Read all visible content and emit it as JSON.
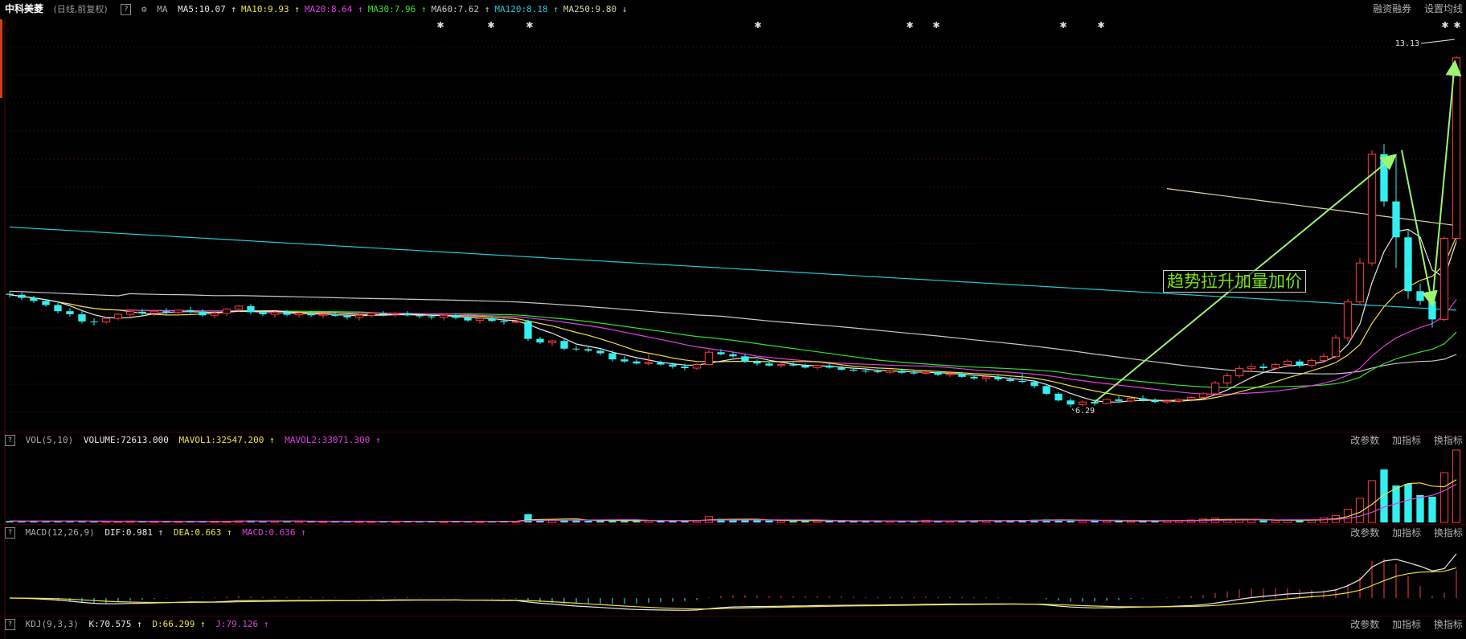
{
  "header": {
    "title": "中科美菱",
    "subtitle": "(日线,前复权)",
    "ma_label": "MA",
    "ma_items": [
      {
        "text": "MA5:10.07",
        "arrow": "↑",
        "color": "#e8e8e8"
      },
      {
        "text": "MA10:9.93",
        "arrow": "↑",
        "color": "#f0e040"
      },
      {
        "text": "MA20:8.64",
        "arrow": "↑",
        "color": "#e040e0"
      },
      {
        "text": "MA30:7.96",
        "arrow": "↑",
        "color": "#30e030"
      },
      {
        "text": "MA60:7.62",
        "arrow": "↑",
        "color": "#c8c8c8"
      },
      {
        "text": "MA120:8.18",
        "arrow": "↑",
        "color": "#20c8d8"
      },
      {
        "text": "MA250:9.80",
        "arrow": "↓",
        "color": "#d8d8a0"
      }
    ],
    "right_links": [
      "融资融券",
      "设置均线"
    ]
  },
  "vol_header": {
    "label": "VOL(5,10)",
    "volume": "VOLUME:72613.000",
    "mavol1": "MAVOL1:32547.200",
    "mavol2": "MAVOL2:33071.300",
    "links": [
      "改参数",
      "加指标",
      "换指标"
    ]
  },
  "macd_header": {
    "label": "MACD(12,26,9)",
    "dif": "DIF:0.981",
    "dea": "DEA:0.663",
    "macd": "MACD:0.636",
    "links": [
      "改参数",
      "加指标",
      "换指标"
    ]
  },
  "kdj_header": {
    "label": "KDJ(9,3,3)",
    "k": "K:70.575",
    "d": "D:66.299",
    "j": "J:79.126",
    "links": [
      "改参数",
      "加指标",
      "换指标"
    ]
  },
  "price_labels": {
    "high": "13.13",
    "low": "6.29"
  },
  "annotation": "趋势拉升加量加价",
  "chart_data": {
    "type": "candlestick",
    "ohlc": [
      [
        8.5,
        8.55,
        8.43,
        8.48
      ],
      [
        8.48,
        8.52,
        8.38,
        8.42
      ],
      [
        8.42,
        8.46,
        8.32,
        8.36
      ],
      [
        8.36,
        8.4,
        8.25,
        8.28
      ],
      [
        8.28,
        8.32,
        8.12,
        8.16
      ],
      [
        8.16,
        8.22,
        8.05,
        8.1
      ],
      [
        8.1,
        8.16,
        7.92,
        7.96
      ],
      [
        7.96,
        8.02,
        7.88,
        7.95
      ],
      [
        7.95,
        8.05,
        7.92,
        8.02
      ],
      [
        8.02,
        8.12,
        7.98,
        8.1
      ],
      [
        8.1,
        8.18,
        8.05,
        8.15
      ],
      [
        8.15,
        8.2,
        8.08,
        8.12
      ],
      [
        8.12,
        8.18,
        8.06,
        8.16
      ],
      [
        8.16,
        8.22,
        8.1,
        8.14
      ],
      [
        8.14,
        8.2,
        8.08,
        8.18
      ],
      [
        8.18,
        8.24,
        8.12,
        8.15
      ],
      [
        8.15,
        8.2,
        8.05,
        8.08
      ],
      [
        8.08,
        8.14,
        8.02,
        8.12
      ],
      [
        8.12,
        8.22,
        8.06,
        8.2
      ],
      [
        8.2,
        8.28,
        8.15,
        8.26
      ],
      [
        8.26,
        8.3,
        8.1,
        8.14
      ],
      [
        8.14,
        8.18,
        8.06,
        8.1
      ],
      [
        8.1,
        8.16,
        8.04,
        8.14
      ],
      [
        8.14,
        8.18,
        8.06,
        8.09
      ],
      [
        8.09,
        8.14,
        8.04,
        8.12
      ],
      [
        8.12,
        8.16,
        8.05,
        8.08
      ],
      [
        8.08,
        8.12,
        8.02,
        8.1
      ],
      [
        8.1,
        8.15,
        8.05,
        8.07
      ],
      [
        8.07,
        8.12,
        8.0,
        8.04
      ],
      [
        8.04,
        8.1,
        7.98,
        8.08
      ],
      [
        8.08,
        8.14,
        8.04,
        8.12
      ],
      [
        8.12,
        8.16,
        8.06,
        8.1
      ],
      [
        8.1,
        8.14,
        8.04,
        8.12
      ],
      [
        8.12,
        8.16,
        8.06,
        8.08
      ],
      [
        8.08,
        8.12,
        8.02,
        8.06
      ],
      [
        8.06,
        8.1,
        8.0,
        8.04
      ],
      [
        8.04,
        8.1,
        7.98,
        8.08
      ],
      [
        8.08,
        8.12,
        8.0,
        8.03
      ],
      [
        8.03,
        8.08,
        7.95,
        7.98
      ],
      [
        7.98,
        8.04,
        7.92,
        8.02
      ],
      [
        8.02,
        8.06,
        7.95,
        7.97
      ],
      [
        7.97,
        8.02,
        7.9,
        7.95
      ],
      [
        7.95,
        8.0,
        7.92,
        7.96
      ],
      [
        7.96,
        8.0,
        7.58,
        7.62
      ],
      [
        7.62,
        7.66,
        7.52,
        7.55
      ],
      [
        7.55,
        7.6,
        7.48,
        7.58
      ],
      [
        7.58,
        7.62,
        7.4,
        7.43
      ],
      [
        7.43,
        7.48,
        7.38,
        7.42
      ],
      [
        7.42,
        7.46,
        7.36,
        7.39
      ],
      [
        7.39,
        7.42,
        7.3,
        7.34
      ],
      [
        7.34,
        7.4,
        7.18,
        7.22
      ],
      [
        7.22,
        7.28,
        7.15,
        7.18
      ],
      [
        7.18,
        7.22,
        7.12,
        7.14
      ],
      [
        7.14,
        7.32,
        7.1,
        7.16
      ],
      [
        7.16,
        7.2,
        7.1,
        7.12
      ],
      [
        7.12,
        7.16,
        7.04,
        7.08
      ],
      [
        7.08,
        7.14,
        7.0,
        7.05
      ],
      [
        7.05,
        7.15,
        7.02,
        7.12
      ],
      [
        7.12,
        7.4,
        7.1,
        7.36
      ],
      [
        7.36,
        7.42,
        7.3,
        7.32
      ],
      [
        7.32,
        7.36,
        7.25,
        7.28
      ],
      [
        7.28,
        7.32,
        7.15,
        7.18
      ],
      [
        7.18,
        7.22,
        7.1,
        7.14
      ],
      [
        7.14,
        7.18,
        7.08,
        7.1
      ],
      [
        7.1,
        7.14,
        7.06,
        7.12
      ],
      [
        7.12,
        7.16,
        7.08,
        7.1
      ],
      [
        7.1,
        7.14,
        7.04,
        7.06
      ],
      [
        7.06,
        7.12,
        7.02,
        7.1
      ],
      [
        7.1,
        7.14,
        7.04,
        7.06
      ],
      [
        7.06,
        7.1,
        7.0,
        7.02
      ],
      [
        7.02,
        7.06,
        6.98,
        7.0
      ],
      [
        7.0,
        7.04,
        6.96,
        6.99
      ],
      [
        6.99,
        7.03,
        6.95,
        6.97
      ],
      [
        6.97,
        7.02,
        6.94,
        7.0
      ],
      [
        7.0,
        7.04,
        6.94,
        6.96
      ],
      [
        6.96,
        7.0,
        6.92,
        6.95
      ],
      [
        6.95,
        7.0,
        6.92,
        6.97
      ],
      [
        6.97,
        7.0,
        6.9,
        6.92
      ],
      [
        6.92,
        6.96,
        6.88,
        6.94
      ],
      [
        6.94,
        6.98,
        6.86,
        6.88
      ],
      [
        6.88,
        6.92,
        6.82,
        6.85
      ],
      [
        6.85,
        6.9,
        6.78,
        6.88
      ],
      [
        6.88,
        6.92,
        6.8,
        6.83
      ],
      [
        6.83,
        6.88,
        6.78,
        6.8
      ],
      [
        6.8,
        6.96,
        6.76,
        6.78
      ],
      [
        6.78,
        6.82,
        6.66,
        6.7
      ],
      [
        6.7,
        6.74,
        6.52,
        6.55
      ],
      [
        6.55,
        6.58,
        6.4,
        6.42
      ],
      [
        6.42,
        6.46,
        6.29,
        6.34
      ],
      [
        6.34,
        6.42,
        6.3,
        6.39
      ],
      [
        6.39,
        6.45,
        6.32,
        6.36
      ],
      [
        6.36,
        6.46,
        6.34,
        6.44
      ],
      [
        6.44,
        6.5,
        6.38,
        6.41
      ],
      [
        6.41,
        6.48,
        6.38,
        6.46
      ],
      [
        6.46,
        6.52,
        6.4,
        6.42
      ],
      [
        6.42,
        6.46,
        6.36,
        6.39
      ],
      [
        6.39,
        6.44,
        6.35,
        6.41
      ],
      [
        6.41,
        6.46,
        6.37,
        6.44
      ],
      [
        6.44,
        6.5,
        6.4,
        6.48
      ],
      [
        6.48,
        6.58,
        6.45,
        6.55
      ],
      [
        6.55,
        6.8,
        6.52,
        6.76
      ],
      [
        6.76,
        6.96,
        6.7,
        6.9
      ],
      [
        6.9,
        7.1,
        6.86,
        7.04
      ],
      [
        7.04,
        7.14,
        6.98,
        7.08
      ],
      [
        7.08,
        7.14,
        7.0,
        7.05
      ],
      [
        7.05,
        7.16,
        7.02,
        7.12
      ],
      [
        7.12,
        7.22,
        7.08,
        7.18
      ],
      [
        7.18,
        7.22,
        7.06,
        7.1
      ],
      [
        7.1,
        7.24,
        7.06,
        7.2
      ],
      [
        7.2,
        7.34,
        7.16,
        7.28
      ],
      [
        7.28,
        7.7,
        7.24,
        7.64
      ],
      [
        7.64,
        8.4,
        7.58,
        8.34
      ],
      [
        8.34,
        9.2,
        8.28,
        9.1
      ],
      [
        9.1,
        11.3,
        9.04,
        11.22
      ],
      [
        11.22,
        11.42,
        10.2,
        10.3
      ],
      [
        10.3,
        11.2,
        9.0,
        9.6
      ],
      [
        9.6,
        9.76,
        8.4,
        8.55
      ],
      [
        8.55,
        8.7,
        8.28,
        8.36
      ],
      [
        8.36,
        8.46,
        7.84,
        8.0
      ],
      [
        8.0,
        9.62,
        7.96,
        9.58
      ],
      [
        9.58,
        13.13,
        9.5,
        13.1
      ]
    ],
    "volume": [
      900,
      800,
      850,
      700,
      900,
      750,
      800,
      700,
      650,
      700,
      800,
      750,
      700,
      650,
      700,
      800,
      750,
      700,
      650,
      900,
      1200,
      800,
      700,
      650,
      700,
      750,
      600,
      650,
      700,
      680,
      700,
      650,
      620,
      600,
      650,
      700,
      620,
      680,
      700,
      650,
      720,
      700,
      680,
      5200,
      1800,
      1400,
      1600,
      1200,
      1000,
      1100,
      1600,
      1200,
      1000,
      1200,
      1100,
      1000,
      1100,
      1200,
      3600,
      2200,
      1600,
      1400,
      1300,
      1200,
      1100,
      1200,
      1100,
      1000,
      900,
      950,
      900,
      850,
      900,
      800,
      850,
      900,
      1200,
      1000,
      900,
      1100,
      1200,
      1000,
      950,
      1300,
      1500,
      1600,
      1800,
      1400,
      1200,
      1100,
      1000,
      1100,
      1000,
      900,
      950,
      1100,
      1000,
      1200,
      1500,
      2100,
      2600,
      1800,
      1600,
      1500,
      1400,
      1300,
      1500,
      1400,
      1600,
      2800,
      4200,
      8200,
      15000,
      26000,
      33000,
      23000,
      24000,
      17000,
      16000,
      31000,
      45000
    ],
    "ylim": [
      6.0,
      13.6
    ]
  }
}
